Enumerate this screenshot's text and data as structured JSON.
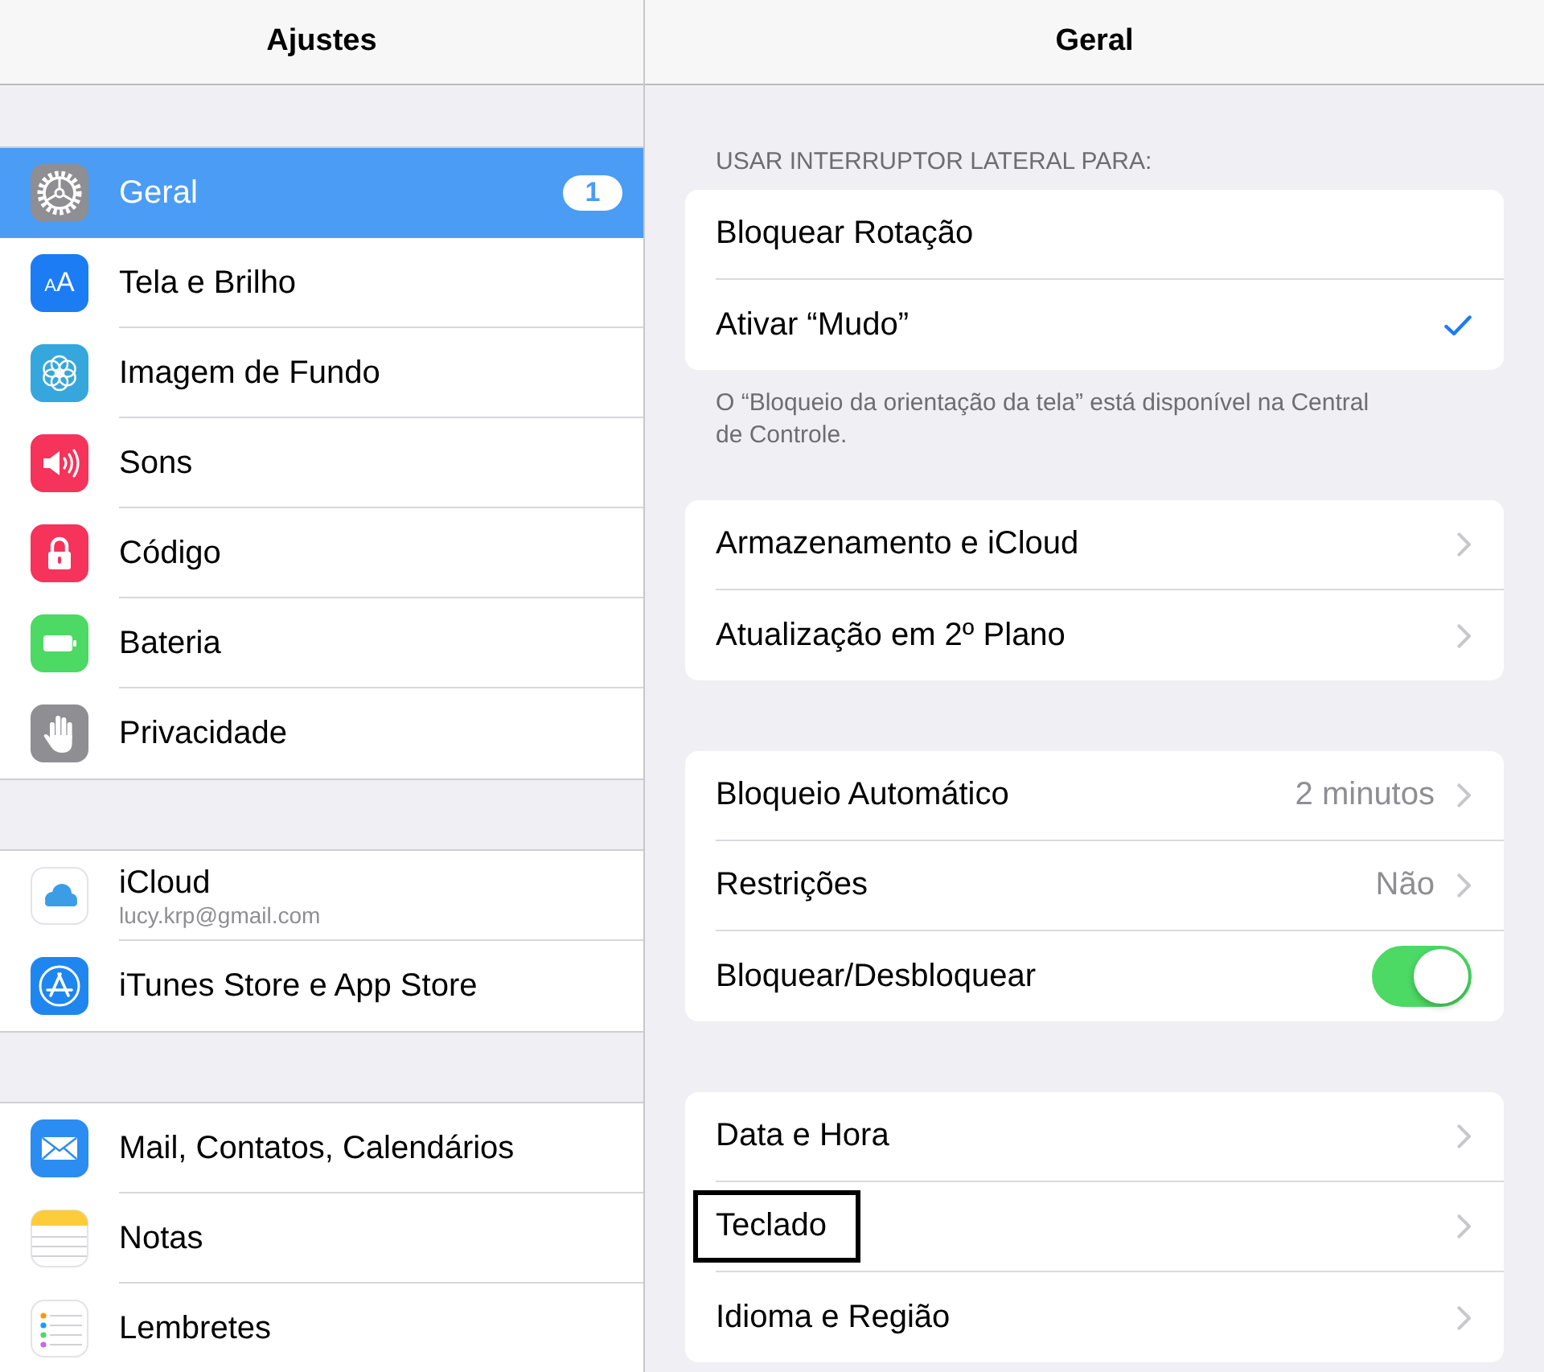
{
  "sidebar": {
    "title": "Ajustes",
    "groups": [
      {
        "items": [
          {
            "label": "Geral",
            "selected": true,
            "badge": "1"
          },
          {
            "label": "Tela e Brilho",
            "selected": false,
            "icon_text": "AA"
          },
          {
            "label": "Imagem de Fundo",
            "selected": false
          },
          {
            "label": "Sons",
            "selected": false
          },
          {
            "label": "Código",
            "selected": false
          },
          {
            "label": "Bateria",
            "selected": false
          },
          {
            "label": "Privacidade",
            "selected": false
          }
        ]
      },
      {
        "items": [
          {
            "label": "iCloud",
            "subtitle": "lucy.krp@gmail.com",
            "selected": false
          },
          {
            "label": "iTunes Store e App Store",
            "selected": false
          }
        ]
      },
      {
        "items": [
          {
            "label": "Mail, Contatos, Calendários",
            "selected": false
          },
          {
            "label": "Notas",
            "selected": false
          },
          {
            "label": "Lembretes",
            "selected": false
          }
        ]
      }
    ]
  },
  "detail": {
    "title": "Geral",
    "groups": [
      {
        "header": "USAR INTERRUPTOR LATERAL PARA:",
        "rows": [
          {
            "kind": "choice",
            "label": "Bloquear Rotação",
            "selected": false,
            "highlighted": false
          },
          {
            "kind": "choice",
            "label": "Ativar “Mudo”",
            "selected": true,
            "highlighted": false
          }
        ],
        "footer": "O “Bloqueio da orientação da tela” está disponível na Central de Controle."
      },
      {
        "rows": [
          {
            "kind": "link",
            "label": "Armazenamento e iCloud",
            "highlighted": false
          },
          {
            "kind": "link",
            "label": "Atualização em 2º Plano",
            "highlighted": false
          }
        ]
      },
      {
        "rows": [
          {
            "kind": "link",
            "label": "Bloqueio Automático",
            "value": "2 minutos",
            "highlighted": false
          },
          {
            "kind": "link",
            "label": "Restrições",
            "value": "Não",
            "highlighted": false
          },
          {
            "kind": "switch",
            "label": "Bloquear/Desbloquear",
            "on": true,
            "highlighted": false
          }
        ]
      },
      {
        "rows": [
          {
            "kind": "link",
            "label": "Data e Hora",
            "highlighted": false
          },
          {
            "kind": "link",
            "label": "Teclado",
            "highlighted": true
          },
          {
            "kind": "link",
            "label": "Idioma e Região",
            "highlighted": false
          }
        ]
      }
    ]
  }
}
